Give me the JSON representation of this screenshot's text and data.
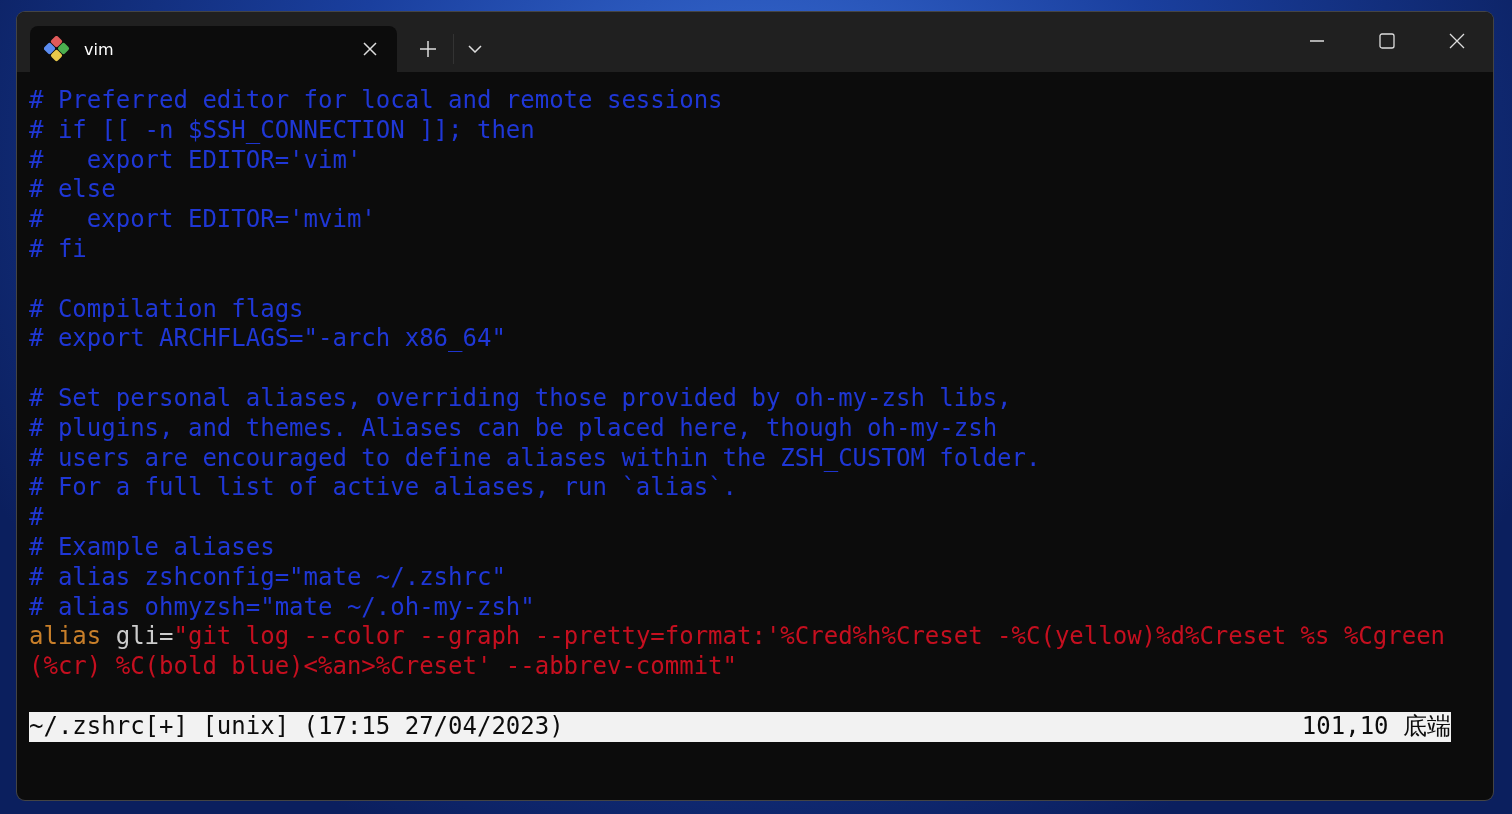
{
  "tab": {
    "title": "vim",
    "selected": true
  },
  "lines": [
    {
      "kind": "comment",
      "text": "# Preferred editor for local and remote sessions"
    },
    {
      "kind": "comment",
      "text": "# if [[ -n $SSH_CONNECTION ]]; then"
    },
    {
      "kind": "comment",
      "text": "#   export EDITOR='vim'"
    },
    {
      "kind": "comment",
      "text": "# else"
    },
    {
      "kind": "comment",
      "text": "#   export EDITOR='mvim'"
    },
    {
      "kind": "comment",
      "text": "# fi"
    },
    {
      "kind": "blank"
    },
    {
      "kind": "comment",
      "text": "# Compilation flags"
    },
    {
      "kind": "comment",
      "text": "# export ARCHFLAGS=\"-arch x86_64\""
    },
    {
      "kind": "blank"
    },
    {
      "kind": "comment",
      "text": "# Set personal aliases, overriding those provided by oh-my-zsh libs,"
    },
    {
      "kind": "comment",
      "text": "# plugins, and themes. Aliases can be placed here, though oh-my-zsh"
    },
    {
      "kind": "comment",
      "text": "# users are encouraged to define aliases within the ZSH_CUSTOM folder."
    },
    {
      "kind": "comment",
      "text": "# For a full list of active aliases, run `alias`."
    },
    {
      "kind": "comment",
      "text": "#"
    },
    {
      "kind": "comment",
      "text": "# Example aliases"
    },
    {
      "kind": "comment",
      "text": "# alias zshconfig=\"mate ~/.zshrc\""
    },
    {
      "kind": "comment",
      "text": "# alias ohmyzsh=\"mate ~/.oh-my-zsh\""
    },
    {
      "kind": "code",
      "segments": [
        {
          "kind": "keyword",
          "text": "alias"
        },
        {
          "kind": "plain",
          "text": " gli="
        },
        {
          "kind": "string",
          "text": "\"git log --color --graph --pretty=format:'%Cred%h%Creset -%C(yellow)%d%Creset %s %Cgreen"
        }
      ]
    },
    {
      "kind": "code",
      "segments": [
        {
          "kind": "string",
          "text": "(%cr) %C(bold blue)<%an>%Creset' --abbrev-commit\""
        }
      ]
    },
    {
      "kind": "blank"
    }
  ],
  "status_bar": {
    "file_info": "~/.zshrc[+] [unix] (17:15 27/04/2023)",
    "position": "101,10 底端"
  }
}
